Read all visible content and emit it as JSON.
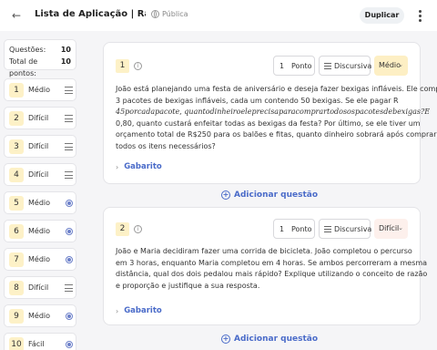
{
  "header": {
    "title": "Lista de Aplicação | Razões...",
    "visibility": "Pública",
    "duplicate_label": "Duplicar"
  },
  "summary": {
    "questions_label": "Questões:",
    "questions_value": "10",
    "points_label": "Total de pontos:",
    "points_value": "10"
  },
  "sidebar": {
    "items": [
      {
        "num": "1",
        "label": "Médio",
        "icon": "lines-icon"
      },
      {
        "num": "2",
        "label": "Difícil",
        "icon": "lines-icon"
      },
      {
        "num": "3",
        "label": "Difícil",
        "icon": "lines-icon"
      },
      {
        "num": "4",
        "label": "Difícil",
        "icon": "lines-icon"
      },
      {
        "num": "5",
        "label": "Médio",
        "icon": "radio-icon"
      },
      {
        "num": "6",
        "label": "Médio",
        "icon": "radio-icon"
      },
      {
        "num": "7",
        "label": "Médio",
        "icon": "radio-icon"
      },
      {
        "num": "8",
        "label": "Difícil",
        "icon": "lines-icon"
      },
      {
        "num": "9",
        "label": "Médio",
        "icon": "radio-icon"
      },
      {
        "num": "10",
        "label": "Fácil",
        "icon": "radio-icon"
      }
    ]
  },
  "questions": [
    {
      "num": "1",
      "points_value": "1",
      "points_label": "Ponto",
      "type_label": "Discursiva",
      "difficulty": "Médio",
      "text_lines": [
        "João está planejando uma festa de aniversário e deseja fazer bexigas infláveis. Ele comprou",
        "3 pacotes de bexigas infláveis, cada um contendo 50 bexigas. Se ele pagar R",
        "45porcadapacote, quantodinheiroeleprecisaparacomprartodosospacotesdebexigas?E",
        "0,80, quanto custará enfeitar todas as bexigas da festa? Por último, se ele tiver um",
        "orçamento total de R$250 para os balões e fitas, quanto dinheiro sobrará após comprar",
        "todos os itens necessários?"
      ],
      "gabarito_label": "Gabarito"
    },
    {
      "num": "2",
      "points_value": "1",
      "points_label": "Ponto",
      "type_label": "Discursiva",
      "difficulty": "Difícil",
      "text_lines": [
        "João e Maria decidiram fazer uma corrida de bicicleta. João completou o percurso",
        "em 3 horas, enquanto Maria completou em 4 horas. Se ambos percorreram a mesma",
        "distância, qual dos dois pedalou mais rápido? Explique utilizando o conceito de razão",
        "e proporção e justifique a sua resposta."
      ],
      "gabarito_label": "Gabarito"
    }
  ],
  "add_question_label": "Adicionar questão",
  "colors": {
    "accent": "#4a6bc9",
    "badge": "#fdf1c7",
    "medio": "#fdefc4",
    "dificil": "#fdf0ec"
  }
}
